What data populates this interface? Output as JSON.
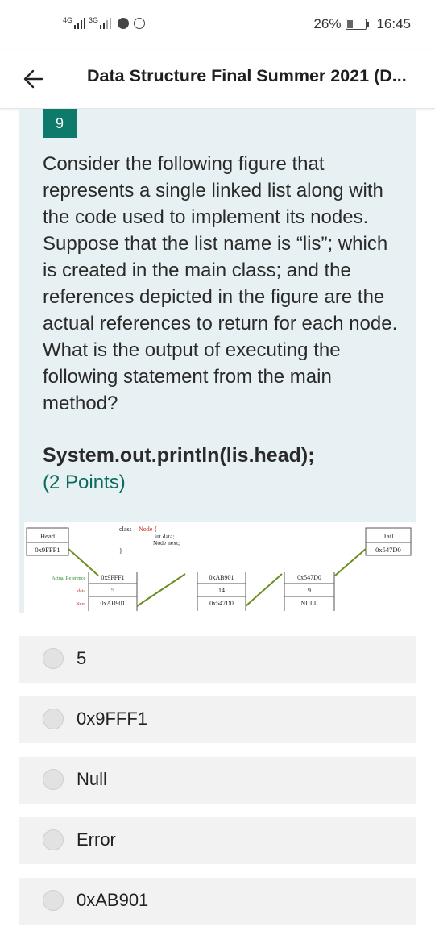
{
  "status_bar": {
    "network1": "4G",
    "network2": "3G",
    "battery_percent": "26%",
    "battery_level": 0.26,
    "time": "16:45",
    "icons": [
      "signal-icon",
      "messenger-icon",
      "whatsapp-icon",
      "battery-icon"
    ]
  },
  "app_bar": {
    "back_icon": "arrow-left-icon",
    "title": "Data Structure Final Summer 2021 (D..."
  },
  "question": {
    "number": "9",
    "text": "Consider the following figure that represents a single linked list along with the code used to implement its nodes. Suppose that the list name is “lis”; which is created in the main class; and the references depicted in the figure are the actual references to return for each node. What is the output of executing the following statement from the main method?",
    "code": "System.out.println(lis.head);",
    "points": "(2 Points)"
  },
  "figure": {
    "head_label": "Head",
    "head_value": "0x9FFF1",
    "tail_label": "Tail",
    "tail_value": "0x547D0",
    "class_decl": "class",
    "class_name": "Node {",
    "field1": "int data;",
    "field2": "Node next;",
    "class_close": "}",
    "row_labels": [
      "Actual Reference",
      "data",
      "Next"
    ],
    "nodes": [
      {
        "ref": "0x9FFF1",
        "data": "5",
        "next": "0xAB901"
      },
      {
        "ref": "0xAB901",
        "data": "14",
        "next": "0x547D0"
      },
      {
        "ref": "0x547D0",
        "data": "9",
        "next": "NULL"
      }
    ],
    "colors": {
      "label_green": "#2e8b2e",
      "class_red": "#cc2222",
      "arrow": "#6b8e23"
    }
  },
  "options": [
    {
      "label": "5"
    },
    {
      "label": "0x9FFF1"
    },
    {
      "label": "Null"
    },
    {
      "label": "Error"
    },
    {
      "label": "0xAB901"
    }
  ],
  "colors": {
    "accent": "#0d7a6b",
    "card_bg": "#e7f0f2",
    "option_bg": "#f2f2f2"
  }
}
